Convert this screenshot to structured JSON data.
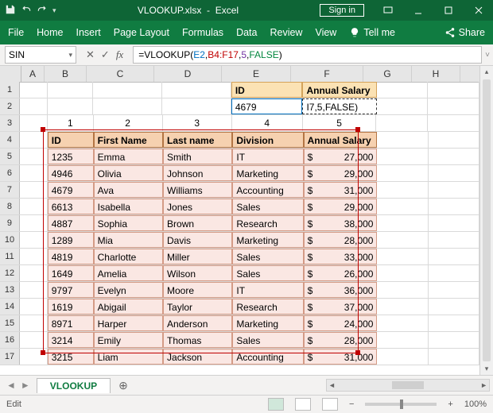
{
  "titlebar": {
    "filename": "VLOOKUP.xlsx",
    "app": "Excel",
    "signin": "Sign in"
  },
  "ribbon": {
    "file": "File",
    "home": "Home",
    "insert": "Insert",
    "pagelayout": "Page Layout",
    "formulas": "Formulas",
    "data": "Data",
    "review": "Review",
    "view": "View",
    "tellme": "Tell me",
    "share": "Share"
  },
  "fbar": {
    "namebox": "SIN",
    "formula_fn": "=VLOOKUP(",
    "formula_a": "E2",
    "formula_b": "B4:F17",
    "formula_c": "5",
    "formula_d": "FALSE",
    "formula_close": ")",
    "fx": "fx",
    "cancel": "✕",
    "enter": "✓",
    "expand": "˅"
  },
  "cols": {
    "A": "A",
    "B": "B",
    "C": "C",
    "D": "D",
    "E": "E",
    "F": "F",
    "G": "G",
    "H": "H"
  },
  "lookup": {
    "id_label": "ID",
    "sal_label": "Annual Salary",
    "id_value": "4679",
    "f2_display": "I7,5,FALSE)"
  },
  "colnums": {
    "b": "1",
    "c": "2",
    "d": "3",
    "e": "4",
    "f": "5"
  },
  "headers": {
    "id": "ID",
    "fn": "First Name",
    "ln": "Last name",
    "div": "Division",
    "sal": "Annual Salary"
  },
  "rows": [
    {
      "id": "1235",
      "fn": "Emma",
      "ln": "Smith",
      "div": "IT",
      "sal": "27,000"
    },
    {
      "id": "4946",
      "fn": "Olivia",
      "ln": "Johnson",
      "div": "Marketing",
      "sal": "29,000"
    },
    {
      "id": "4679",
      "fn": "Ava",
      "ln": "Williams",
      "div": "Accounting",
      "sal": "31,000"
    },
    {
      "id": "6613",
      "fn": "Isabella",
      "ln": "Jones",
      "div": "Sales",
      "sal": "29,000"
    },
    {
      "id": "4887",
      "fn": "Sophia",
      "ln": "Brown",
      "div": "Research",
      "sal": "38,000"
    },
    {
      "id": "1289",
      "fn": "Mia",
      "ln": "Davis",
      "div": "Marketing",
      "sal": "28,000"
    },
    {
      "id": "4819",
      "fn": "Charlotte",
      "ln": "Miller",
      "div": "Sales",
      "sal": "33,000"
    },
    {
      "id": "1649",
      "fn": "Amelia",
      "ln": "Wilson",
      "div": "Sales",
      "sal": "26,000"
    },
    {
      "id": "9797",
      "fn": "Evelyn",
      "ln": "Moore",
      "div": "IT",
      "sal": "36,000"
    },
    {
      "id": "1619",
      "fn": "Abigail",
      "ln": "Taylor",
      "div": "Research",
      "sal": "37,000"
    },
    {
      "id": "8971",
      "fn": "Harper",
      "ln": "Anderson",
      "div": "Marketing",
      "sal": "24,000"
    },
    {
      "id": "3214",
      "fn": "Emily",
      "ln": "Thomas",
      "div": "Sales",
      "sal": "28,000"
    },
    {
      "id": "3215",
      "fn": "Liam",
      "ln": "Jackson",
      "div": "Accounting",
      "sal": "31,000"
    }
  ],
  "currency": "$",
  "sheets": {
    "tab": "VLOOKUP",
    "add": "⊕"
  },
  "status": {
    "mode": "Edit",
    "zoom": "100%",
    "minus": "−",
    "plus": "+"
  }
}
